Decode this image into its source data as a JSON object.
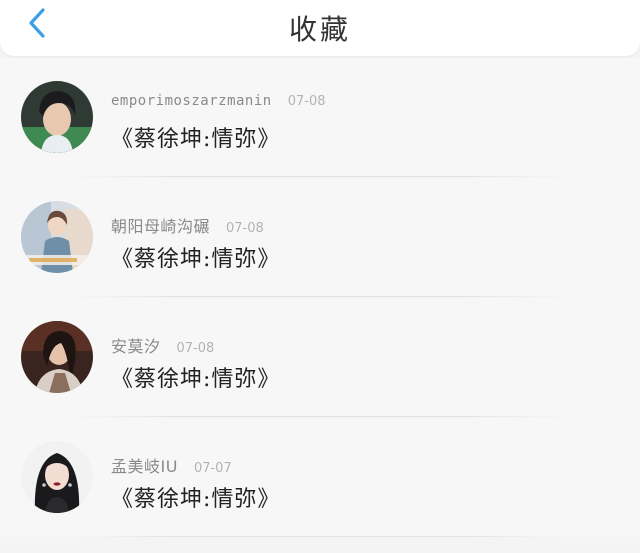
{
  "header": {
    "title": "收藏",
    "back_icon": "chevron-left-icon",
    "accent_color": "#3aa0e6"
  },
  "items": [
    {
      "username": "emporimoszarzmanin",
      "date": "07-08",
      "content": "《蔡徐坤:情弥》",
      "avatar_icon": "avatar-photo-1"
    },
    {
      "username": "朝阳母崎沟碾",
      "date": "07-08",
      "content": "《蔡徐坤:情弥》",
      "avatar_icon": "avatar-photo-2"
    },
    {
      "username": "安莫汐",
      "date": "07-08",
      "content": "《蔡徐坤:情弥》",
      "avatar_icon": "avatar-photo-3"
    },
    {
      "username": "孟美岐IU",
      "date": "07-07",
      "content": "《蔡徐坤:情弥》",
      "avatar_icon": "avatar-photo-4"
    }
  ]
}
